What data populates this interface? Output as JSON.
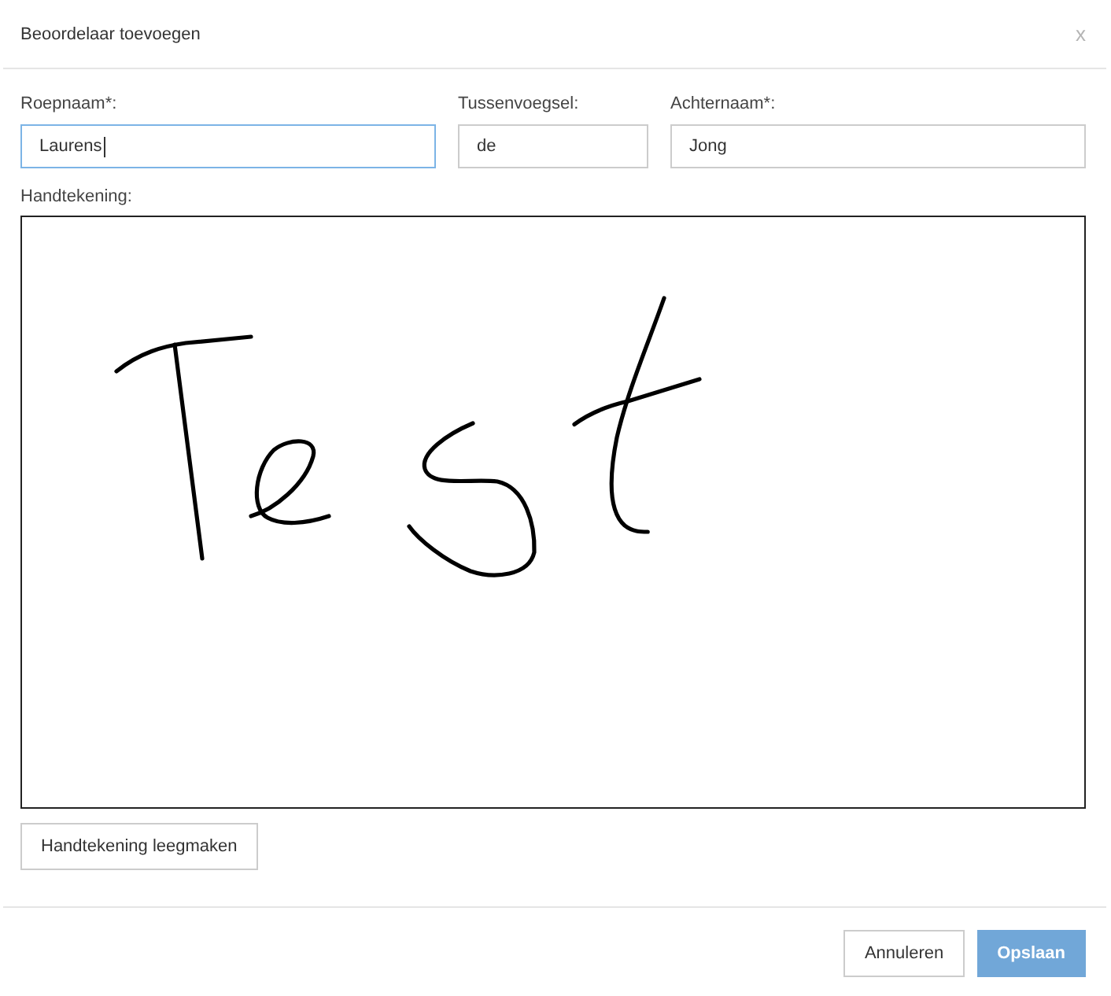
{
  "dialog": {
    "title": "Beoordelaar toevoegen",
    "close_label": "x"
  },
  "fields": [
    {
      "label": "Roepnaam*:",
      "value": "Laurens",
      "focused": true
    },
    {
      "label": "Tussenvoegsel:",
      "value": "de",
      "focused": false
    },
    {
      "label": "Achternaam*:",
      "value": "Jong",
      "focused": false
    }
  ],
  "signature": {
    "label": "Handtekening:",
    "signed": true,
    "clear_button": "Handtekening leegmaken"
  },
  "footer": {
    "buttons": [
      {
        "label": "Annuleren",
        "kind": "default"
      },
      {
        "label": "Opslaan",
        "kind": "primary"
      }
    ]
  }
}
